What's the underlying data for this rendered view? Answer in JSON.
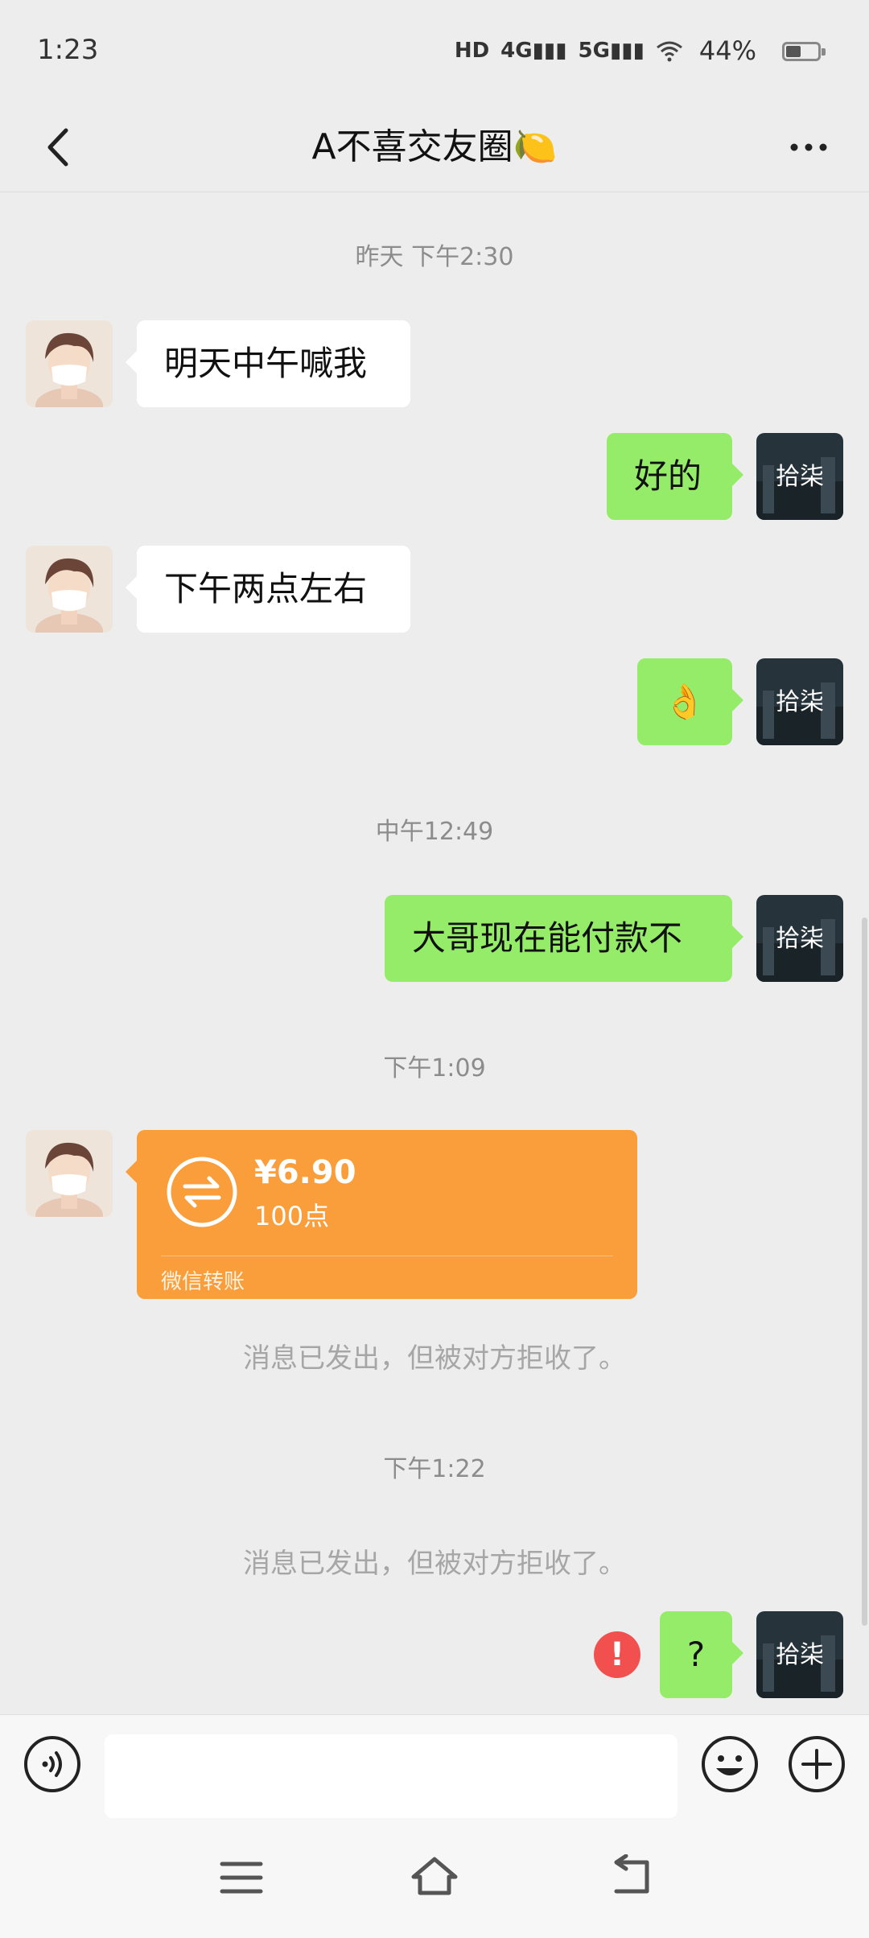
{
  "status_bar": {
    "time": "1:23",
    "network_icons": [
      "HD",
      "4G",
      "5G",
      "wifi"
    ],
    "battery_percent": "44%"
  },
  "header": {
    "title": "A不喜交友圈🍋"
  },
  "messages": {
    "ts1": "昨天 下午2:30",
    "m1": "明天中午喊我",
    "m2": "好的",
    "m3": "下午两点左右",
    "m4": "👌",
    "ts2": "中午12:49",
    "m5": "大哥现在能付款不",
    "ts3": "下午1:09",
    "transfer": {
      "amount": "¥6.90",
      "note": "100点",
      "label": "微信转账"
    },
    "sys1": "消息已发出，但被对方拒收了。",
    "ts4": "下午1:22",
    "sys2": "消息已发出，但被对方拒收了。",
    "error_mark": "!",
    "m6": "?"
  },
  "input_bar": {
    "placeholder": ""
  },
  "colors": {
    "bubble_out": "#95ec69",
    "bubble_in": "#ffffff",
    "transfer": "#fa9d3b",
    "background": "#ededed"
  }
}
